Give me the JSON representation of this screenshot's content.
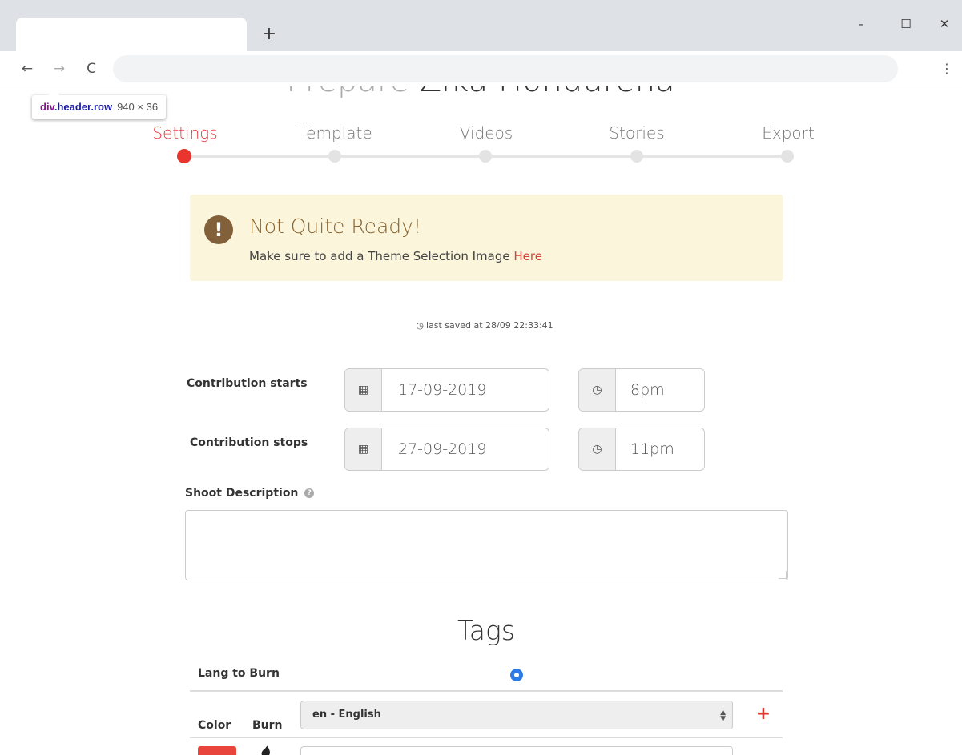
{
  "browser": {
    "new_tab_glyph": "+",
    "minimize_glyph": "–",
    "maximize_glyph": "☐",
    "close_glyph": "✕",
    "back_glyph": "←",
    "forward_glyph": "→",
    "reload_glyph": "C",
    "menu_glyph": "⋮"
  },
  "devtools_tooltip": {
    "tag": "div",
    "class": ".header.row",
    "size": "940 × 36"
  },
  "header": {
    "title_light": "Prepare",
    "title_dark": "Zika Hondureña"
  },
  "steps": [
    {
      "label": "Settings",
      "active": true
    },
    {
      "label": "Template",
      "active": false
    },
    {
      "label": "Videos",
      "active": false
    },
    {
      "label": "Stories",
      "active": false
    },
    {
      "label": "Export",
      "active": false
    }
  ],
  "alert": {
    "icon_glyph": "!",
    "title": "Not Quite Ready!",
    "text": "Make sure to add a Theme Selection Image",
    "link": "Here"
  },
  "status": {
    "last_saved": "last saved at 28/09 22:33:41"
  },
  "contribution": {
    "starts_label": "Contribution starts",
    "starts_date": "17-09-2019",
    "starts_time": "8pm",
    "stops_label": "Contribution stops",
    "stops_date": "27-09-2019",
    "stops_time": "11pm",
    "calendar_glyph": "▦",
    "clock_glyph": "◷"
  },
  "description": {
    "label": "Shoot Description",
    "help_glyph": "?",
    "value": ""
  },
  "tags": {
    "title": "Tags",
    "lang_to_burn_label": "Lang to Burn",
    "color_header": "Color",
    "burn_header": "Burn",
    "language_selected": "en - English",
    "add_glyph": "+"
  },
  "colors": {
    "accent_red": "#e8362e",
    "alert_bg": "#fbf5dc",
    "alert_title": "#8a6530",
    "radio_blue": "#2e7ae6"
  }
}
